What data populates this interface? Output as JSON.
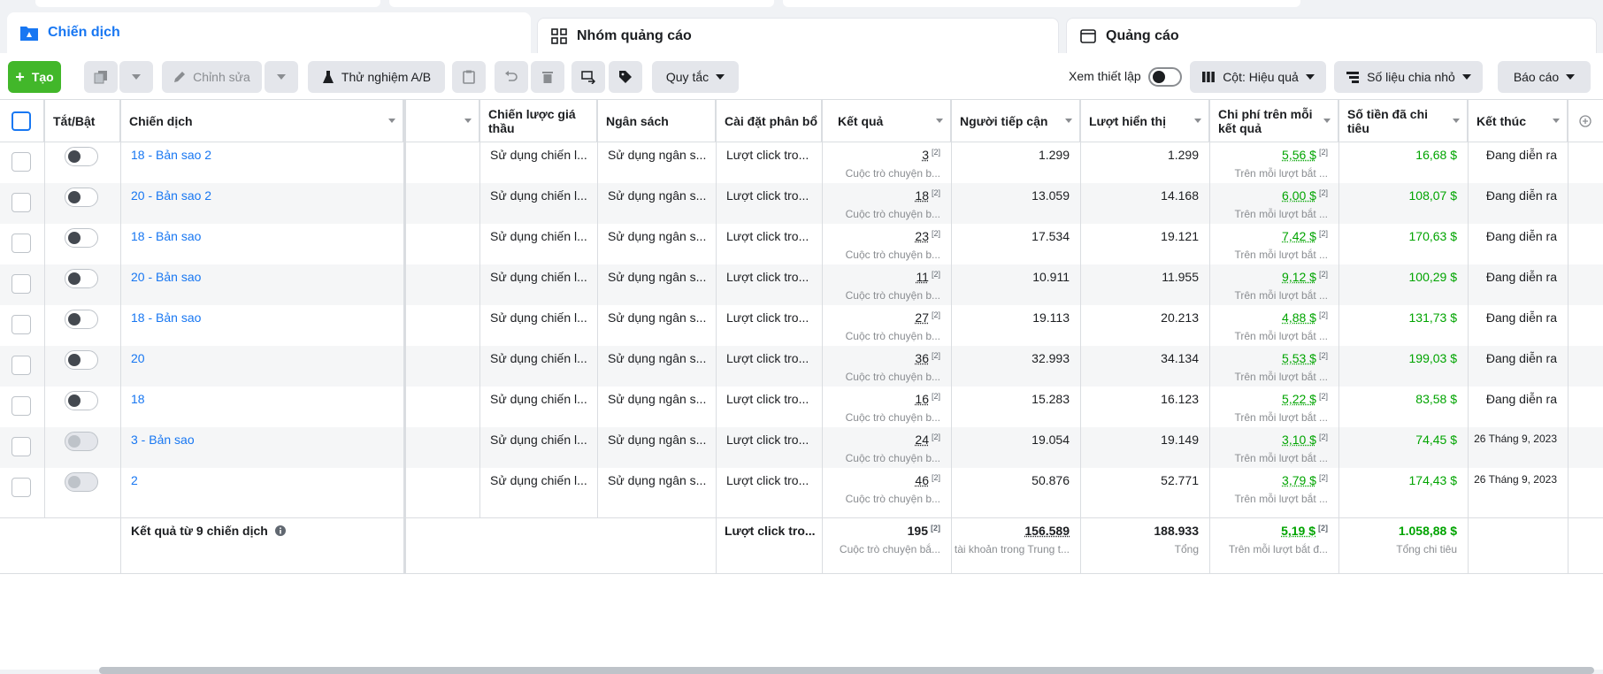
{
  "tabs": [
    {
      "label": "Chiến dịch",
      "icon": "folder-icon"
    },
    {
      "label": "Nhóm quảng cáo",
      "icon": "grid-icon"
    },
    {
      "label": "Quảng cáo",
      "icon": "ad-icon"
    }
  ],
  "toolbar": {
    "create_label": "Tạo",
    "edit_label": "Chỉnh sửa",
    "ab_test_label": "Thử nghiệm A/B",
    "rules_label": "Quy tắc",
    "view_setup_label": "Xem thiết lập",
    "columns_label": "Cột: Hiệu quả",
    "breakdown_label": "Số liệu chia nhỏ",
    "reports_label": "Báo cáo"
  },
  "columns": {
    "onoff": "Tắt/Bật",
    "campaign": "Chiến dịch",
    "bid_strategy": "Chiến lược giá thầu",
    "budget": "Ngân sách",
    "attribution": "Cài đặt phân bổ",
    "results": "Kết quả",
    "reach": "Người tiếp cận",
    "impressions": "Lượt hiển thị",
    "cost_per_result": "Chi phí trên mỗi kết quả",
    "amount_spent": "Số tiền đã chi tiêu",
    "ends": "Kết thúc"
  },
  "rows": [
    {
      "name": "18 - Bản sao 2",
      "on": true,
      "bid": "Sử dụng chiến l...",
      "budget": "Sử dụng ngân s...",
      "attr": "Lượt click tro...",
      "results": "3",
      "results_sub": "Cuộc trò chuyện b...",
      "reach": "1.299",
      "impr": "1.299",
      "cpr": "5,56 $",
      "cpr_sub": "Trên mỗi lượt bắt ...",
      "spent": "16,68 $",
      "ends": "Đang diễn ra"
    },
    {
      "name": "20 - Bản sao 2",
      "on": true,
      "bid": "Sử dụng chiến l...",
      "budget": "Sử dụng ngân s...",
      "attr": "Lượt click tro...",
      "results": "18",
      "results_sub": "Cuộc trò chuyện b...",
      "reach": "13.059",
      "impr": "14.168",
      "cpr": "6,00 $",
      "cpr_sub": "Trên mỗi lượt bắt ...",
      "spent": "108,07 $",
      "ends": "Đang diễn ra"
    },
    {
      "name": "18 - Bản sao",
      "on": true,
      "bid": "Sử dụng chiến l...",
      "budget": "Sử dụng ngân s...",
      "attr": "Lượt click tro...",
      "results": "23",
      "results_sub": "Cuộc trò chuyện b...",
      "reach": "17.534",
      "impr": "19.121",
      "cpr": "7,42 $",
      "cpr_sub": "Trên mỗi lượt bắt ...",
      "spent": "170,63 $",
      "ends": "Đang diễn ra"
    },
    {
      "name": "20 - Bản sao",
      "on": true,
      "bid": "Sử dụng chiến l...",
      "budget": "Sử dụng ngân s...",
      "attr": "Lượt click tro...",
      "results": "11",
      "results_sub": "Cuộc trò chuyện b...",
      "reach": "10.911",
      "impr": "11.955",
      "cpr": "9,12 $",
      "cpr_sub": "Trên mỗi lượt bắt ...",
      "spent": "100,29 $",
      "ends": "Đang diễn ra"
    },
    {
      "name": "18 - Bản sao",
      "on": true,
      "bid": "Sử dụng chiến l...",
      "budget": "Sử dụng ngân s...",
      "attr": "Lượt click tro...",
      "results": "27",
      "results_sub": "Cuộc trò chuyện b...",
      "reach": "19.113",
      "impr": "20.213",
      "cpr": "4,88 $",
      "cpr_sub": "Trên mỗi lượt bắt ...",
      "spent": "131,73 $",
      "ends": "Đang diễn ra"
    },
    {
      "name": "20",
      "on": true,
      "bid": "Sử dụng chiến l...",
      "budget": "Sử dụng ngân s...",
      "attr": "Lượt click tro...",
      "results": "36",
      "results_sub": "Cuộc trò chuyện b...",
      "reach": "32.993",
      "impr": "34.134",
      "cpr": "5,53 $",
      "cpr_sub": "Trên mỗi lượt bắt ...",
      "spent": "199,03 $",
      "ends": "Đang diễn ra"
    },
    {
      "name": "18",
      "on": true,
      "bid": "Sử dụng chiến l...",
      "budget": "Sử dụng ngân s...",
      "attr": "Lượt click tro...",
      "results": "16",
      "results_sub": "Cuộc trò chuyện b...",
      "reach": "15.283",
      "impr": "16.123",
      "cpr": "5,22 $",
      "cpr_sub": "Trên mỗi lượt bắt ...",
      "spent": "83,58 $",
      "ends": "Đang diễn ra"
    },
    {
      "name": "3 - Bản sao",
      "on": false,
      "bid": "Sử dụng chiến l...",
      "budget": "Sử dụng ngân s...",
      "attr": "Lượt click tro...",
      "results": "24",
      "results_sub": "Cuộc trò chuyện b...",
      "reach": "19.054",
      "impr": "19.149",
      "cpr": "3,10 $",
      "cpr_sub": "Trên mỗi lượt bắt ...",
      "spent": "74,45 $",
      "ends": "26 Tháng 9, 2023"
    },
    {
      "name": "2",
      "on": false,
      "bid": "Sử dụng chiến l...",
      "budget": "Sử dụng ngân s...",
      "attr": "Lượt click tro...",
      "results": "46",
      "results_sub": "Cuộc trò chuyện b...",
      "reach": "50.876",
      "impr": "52.771",
      "cpr": "3,79 $",
      "cpr_sub": "Trên mỗi lượt bắt ...",
      "spent": "174,43 $",
      "ends": "26 Tháng 9, 2023"
    }
  ],
  "totals": {
    "label": "Kết quả từ 9 chiến dịch",
    "attr": "Lượt click tro...",
    "results": "195",
    "results_sub": "Cuộc trò chuyện bắ...",
    "reach": "156.589",
    "reach_sub": "tài khoản trong Trung t...",
    "impr": "188.933",
    "impr_sub": "Tổng",
    "cpr": "5,19 $",
    "cpr_sub": "Trên mỗi lượt bắt đ...",
    "spent": "1.058,88 $",
    "spent_sub": "Tổng chi tiêu"
  },
  "superscript": "[2]",
  "colors": {
    "accent": "#1877f2",
    "create": "#42b72a",
    "money": "#00a400"
  }
}
